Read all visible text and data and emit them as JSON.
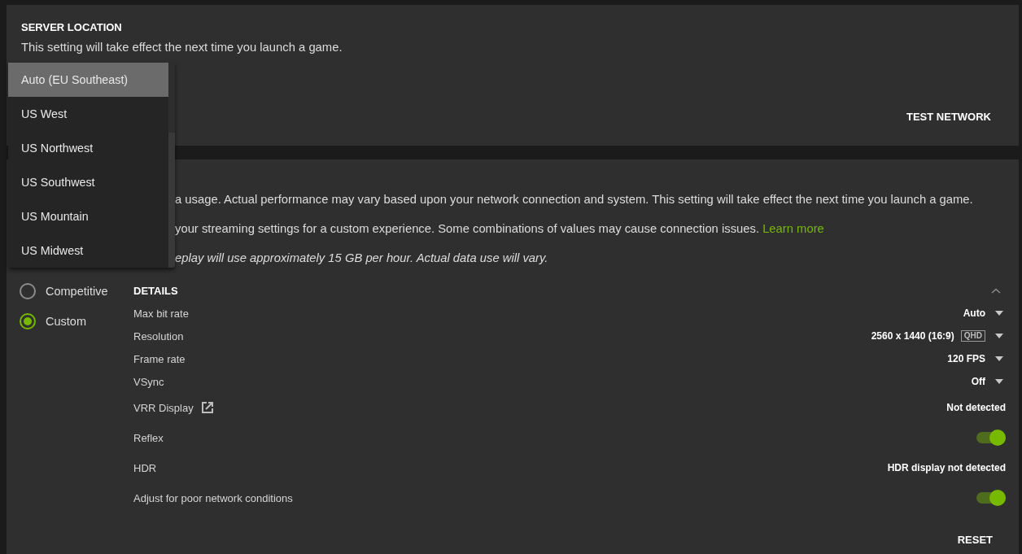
{
  "server_location": {
    "title": "SERVER LOCATION",
    "description": "This setting will take effect the next time you launch a game.",
    "location_menu": {
      "options": [
        {
          "label": "Auto (EU Southeast)",
          "selected": true
        },
        {
          "label": "US West",
          "selected": false
        },
        {
          "label": "US Northwest",
          "selected": false
        },
        {
          "label": "US Southwest",
          "selected": false
        },
        {
          "label": "US Mountain",
          "selected": false
        },
        {
          "label": "US Midwest",
          "selected": false
        }
      ]
    },
    "test_network_button": "TEST NETWORK"
  },
  "streaming_quality": {
    "description_lines": [
      {
        "kind": "plain",
        "text": "a usage. Actual performance may vary based upon your network connection and system. This setting will take effect the next time you launch a game."
      },
      {
        "kind": "plain",
        "text": "your streaming settings for a custom experience. Some combinations of values may cause connection issues.",
        "link": "Learn more"
      },
      {
        "kind": "note",
        "text": "eplay will use approximately 15 GB per hour. Actual data use will vary."
      }
    ],
    "presets": [
      {
        "label": "Competitive",
        "selected": false
      },
      {
        "label": "Custom",
        "selected": true
      }
    ],
    "details": {
      "title": "DETAILS",
      "expanded": true,
      "settings": [
        {
          "kind": "dropdown",
          "label": "Max bit rate",
          "value": "Auto"
        },
        {
          "kind": "dropdown",
          "label": "Resolution",
          "value": "2560 x 1440 (16:9)",
          "tag": "QHD"
        },
        {
          "kind": "dropdown",
          "label": "Frame rate",
          "value": "120 FPS"
        },
        {
          "kind": "dropdown",
          "label": "VSync",
          "value": "Off"
        },
        {
          "kind": "status",
          "label": "VRR Display",
          "value": "Not detected",
          "external_link": true
        },
        {
          "kind": "toggle",
          "label": "Reflex",
          "on": true
        },
        {
          "kind": "status",
          "label": "HDR",
          "value": "HDR display not detected"
        },
        {
          "kind": "toggle",
          "label": "Adjust for poor network conditions",
          "on": true
        }
      ]
    },
    "reset_button": "RESET"
  }
}
